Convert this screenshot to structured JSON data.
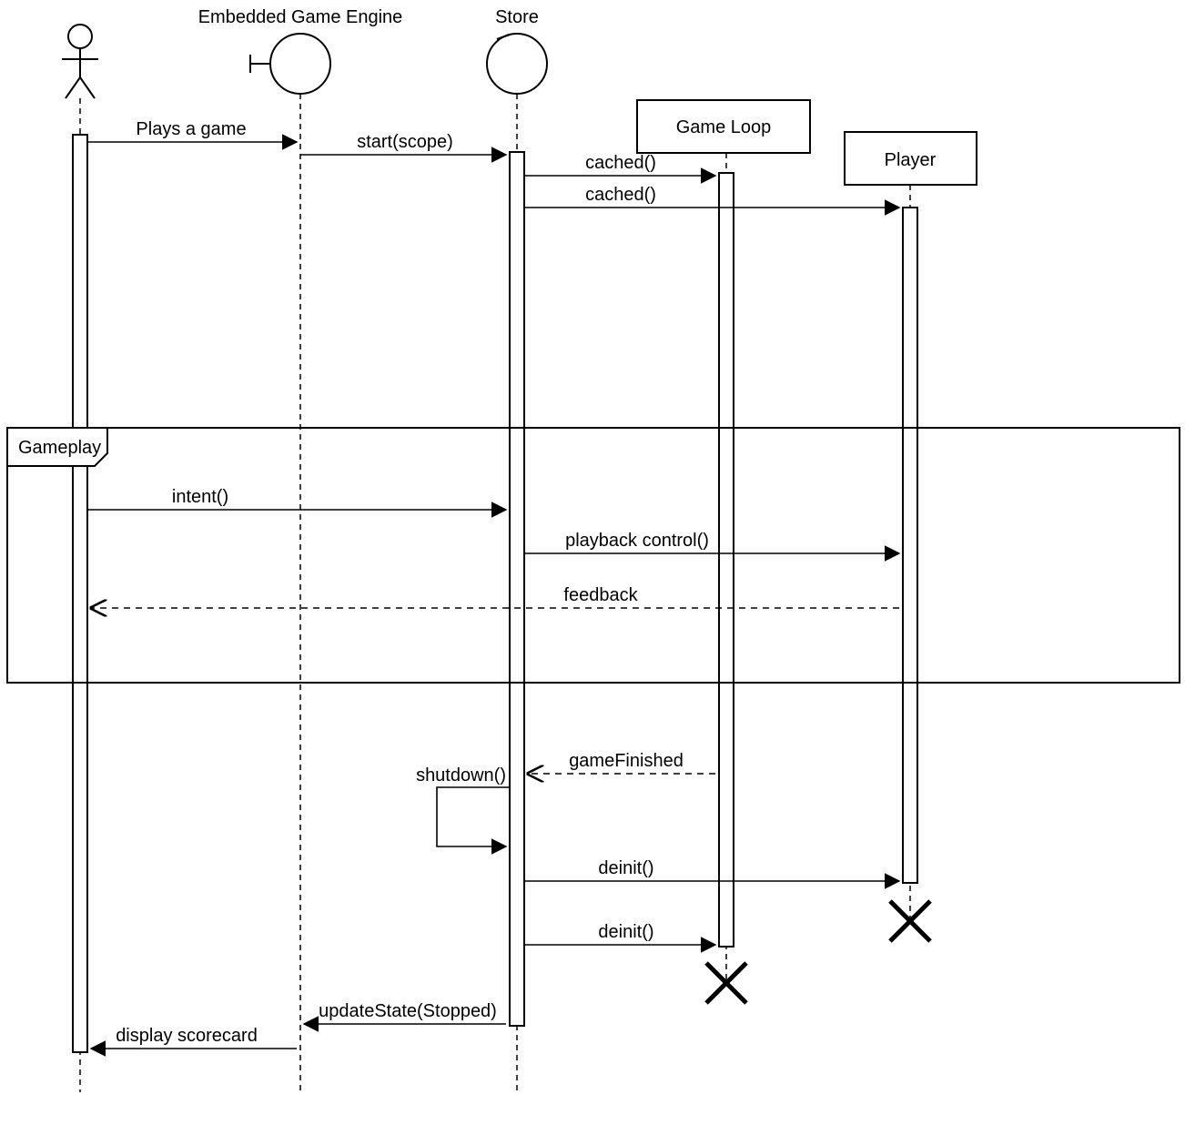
{
  "diagram": {
    "type": "uml-sequence",
    "fragment_label": "Gameplay",
    "participants": {
      "actor": {
        "kind": "actor"
      },
      "engine": {
        "kind": "control",
        "label": "Embedded Game Engine"
      },
      "store": {
        "kind": "entity",
        "label": "Store"
      },
      "gameloop": {
        "kind": "object",
        "label": "Game Loop"
      },
      "player": {
        "kind": "object",
        "label": "Player"
      }
    },
    "messages": {
      "m1": {
        "text": "Plays a game",
        "from": "actor",
        "to": "engine",
        "style": "sync"
      },
      "m2": {
        "text": "start(scope)",
        "from": "engine",
        "to": "store",
        "style": "sync"
      },
      "m3": {
        "text": "cached()",
        "from": "store",
        "to": "gameloop",
        "style": "sync",
        "creates": true
      },
      "m4": {
        "text": "cached()",
        "from": "store",
        "to": "player",
        "style": "sync",
        "creates": true
      },
      "m5": {
        "text": "intent()",
        "from": "actor",
        "to": "store",
        "style": "sync"
      },
      "m6": {
        "text": "playback control()",
        "from": "store",
        "to": "player",
        "style": "sync"
      },
      "m7": {
        "text": "feedback",
        "from": "player",
        "to": "actor",
        "style": "return"
      },
      "m8": {
        "text": "gameFinished",
        "from": "gameloop",
        "to": "store",
        "style": "return"
      },
      "m9": {
        "text": "shutdown()",
        "from": "store",
        "to": "store",
        "style": "self"
      },
      "m10": {
        "text": "deinit()",
        "from": "store",
        "to": "player",
        "style": "sync",
        "destroys": true
      },
      "m11": {
        "text": "deinit()",
        "from": "store",
        "to": "gameloop",
        "style": "sync",
        "destroys": true
      },
      "m12": {
        "text": "updateState(Stopped)",
        "from": "store",
        "to": "engine",
        "style": "sync"
      },
      "m13": {
        "text": "display scorecard",
        "from": "engine",
        "to": "actor",
        "style": "sync"
      }
    }
  }
}
